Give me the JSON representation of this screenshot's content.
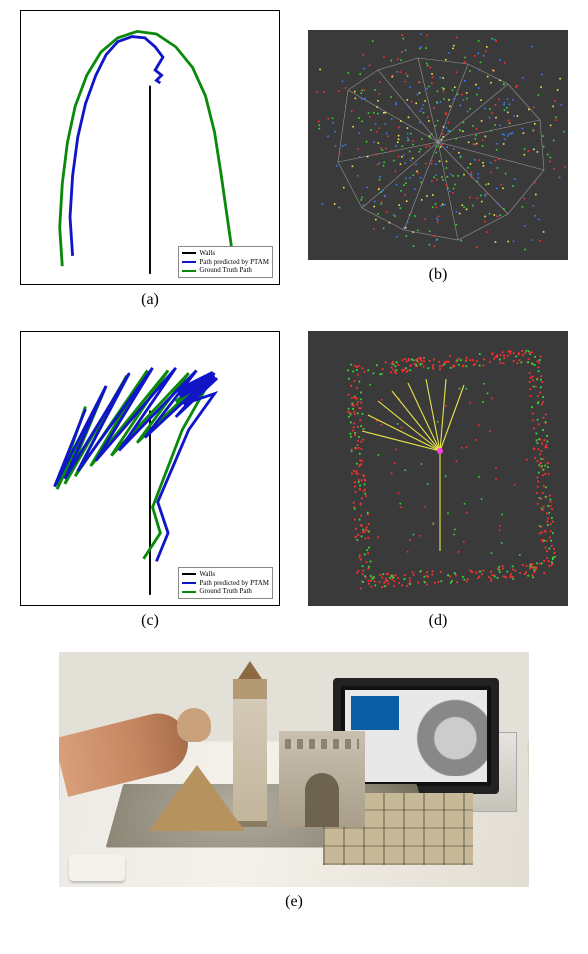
{
  "figure": {
    "panels": {
      "a": {
        "label": "(a)"
      },
      "b": {
        "label": "(b)"
      },
      "c": {
        "label": "(c)"
      },
      "d": {
        "label": "(d)"
      },
      "e": {
        "label": "(e)"
      }
    },
    "legend_a": {
      "items": [
        {
          "label": "Walls",
          "color": "#000000"
        },
        {
          "label": "Path predicted by PTAM",
          "color": "#1015c8"
        },
        {
          "label": "Ground Truth Path",
          "color": "#0a8a0a"
        }
      ]
    },
    "legend_c": {
      "items": [
        {
          "label": "Walls",
          "color": "#000000"
        },
        {
          "label": "Path predicted by PTAM",
          "color": "#1015c8"
        },
        {
          "label": "Ground Truth Path",
          "color": "#0a8a0a"
        }
      ]
    }
  },
  "chart_data": [
    {
      "id": "a",
      "type": "line",
      "title": "",
      "xlabel": "",
      "ylabel": "",
      "description": "Top-down view of trajectories; estimated (blue) vs ground-truth (green) arc-shaped path around a wall segment.",
      "series": [
        {
          "name": "Walls",
          "color": "#000000",
          "points": [
            [
              0.0,
              -0.98
            ],
            [
              0.0,
              0.48
            ]
          ]
        },
        {
          "name": "Ground Truth Path",
          "color": "#0a8a0a",
          "points": [
            [
              0.65,
              -0.9
            ],
            [
              0.6,
              -0.55
            ],
            [
              0.55,
              -0.2
            ],
            [
              0.5,
              0.12
            ],
            [
              0.43,
              0.4
            ],
            [
              0.33,
              0.62
            ],
            [
              0.2,
              0.78
            ],
            [
              0.05,
              0.88
            ],
            [
              -0.1,
              0.9
            ],
            [
              -0.25,
              0.85
            ],
            [
              -0.38,
              0.74
            ],
            [
              -0.49,
              0.56
            ],
            [
              -0.58,
              0.32
            ],
            [
              -0.64,
              0.04
            ],
            [
              -0.68,
              -0.28
            ],
            [
              -0.7,
              -0.62
            ],
            [
              -0.68,
              -0.92
            ]
          ]
        },
        {
          "name": "Path predicted by PTAM",
          "color": "#1015c8",
          "points": [
            [
              0.08,
              0.5
            ],
            [
              0.05,
              0.52
            ],
            [
              0.09,
              0.56
            ],
            [
              0.04,
              0.6
            ],
            [
              0.1,
              0.7
            ],
            [
              0.04,
              0.78
            ],
            [
              -0.04,
              0.85
            ],
            [
              -0.14,
              0.86
            ],
            [
              -0.25,
              0.82
            ],
            [
              -0.34,
              0.72
            ],
            [
              -0.42,
              0.56
            ],
            [
              -0.5,
              0.34
            ],
            [
              -0.56,
              0.08
            ],
            [
              -0.6,
              -0.22
            ],
            [
              -0.62,
              -0.54
            ],
            [
              -0.6,
              -0.84
            ]
          ]
        }
      ],
      "xlim": [
        -1,
        1
      ],
      "ylim": [
        -1,
        1
      ]
    },
    {
      "id": "b",
      "type": "scatter",
      "title": "",
      "description": "3-D sparse point cloud (red/green/blue/yellow feature points) with thin grey camera frusta radiating from a central cluster on a dark background.",
      "series": [],
      "note": "Point positions are qualitative; no numeric axes are shown."
    },
    {
      "id": "c",
      "type": "line",
      "title": "",
      "xlabel": "",
      "ylabel": "",
      "description": "Top-down zig-zag scanning trajectory; estimated (blue) vs ground-truth (green), fan-shaped sweep beside a wall.",
      "series": [
        {
          "name": "Walls",
          "color": "#000000",
          "points": [
            [
              0.0,
              -0.98
            ],
            [
              0.0,
              0.45
            ]
          ]
        },
        {
          "name": "Ground Truth Path",
          "color": "#0a8a0a",
          "points": [
            [
              -0.05,
              -0.7
            ],
            [
              0.08,
              -0.5
            ],
            [
              0.02,
              -0.3
            ],
            [
              0.25,
              0.3
            ],
            [
              0.42,
              0.6
            ],
            [
              0.2,
              0.52
            ],
            [
              0.44,
              0.72
            ],
            [
              -0.1,
              0.2
            ],
            [
              0.3,
              0.74
            ],
            [
              -0.3,
              0.1
            ],
            [
              0.14,
              0.76
            ],
            [
              -0.46,
              0.02
            ],
            [
              -0.02,
              0.76
            ],
            [
              -0.58,
              -0.06
            ],
            [
              -0.18,
              0.72
            ],
            [
              -0.66,
              -0.12
            ],
            [
              -0.34,
              0.64
            ],
            [
              -0.72,
              -0.16
            ],
            [
              -0.5,
              0.48
            ]
          ]
        },
        {
          "name": "Path predicted by PTAM",
          "color": "#1015c8",
          "points": [
            [
              0.05,
              -0.72
            ],
            [
              0.14,
              -0.5
            ],
            [
              0.06,
              -0.26
            ],
            [
              0.3,
              0.3
            ],
            [
              0.5,
              0.58
            ],
            [
              0.26,
              0.5
            ],
            [
              0.52,
              0.7
            ],
            [
              0.2,
              0.4
            ],
            [
              0.5,
              0.74
            ],
            [
              -0.04,
              0.24
            ],
            [
              0.36,
              0.76
            ],
            [
              -0.24,
              0.14
            ],
            [
              0.2,
              0.78
            ],
            [
              -0.42,
              0.06
            ],
            [
              0.02,
              0.78
            ],
            [
              -0.56,
              -0.02
            ],
            [
              -0.16,
              0.74
            ],
            [
              -0.66,
              -0.08
            ],
            [
              -0.34,
              0.64
            ],
            [
              -0.74,
              -0.14
            ],
            [
              -0.5,
              0.46
            ]
          ]
        }
      ],
      "xlim": [
        -1,
        1
      ],
      "ylim": [
        -1,
        1
      ]
    },
    {
      "id": "d",
      "type": "scatter",
      "title": "",
      "description": "Top-down reconstructed map: rectangular room outline of sparse red/green points, interior yellow camera-pose fan following a path.",
      "series": [],
      "note": "Point positions are qualitative; no numeric axes are shown."
    }
  ]
}
